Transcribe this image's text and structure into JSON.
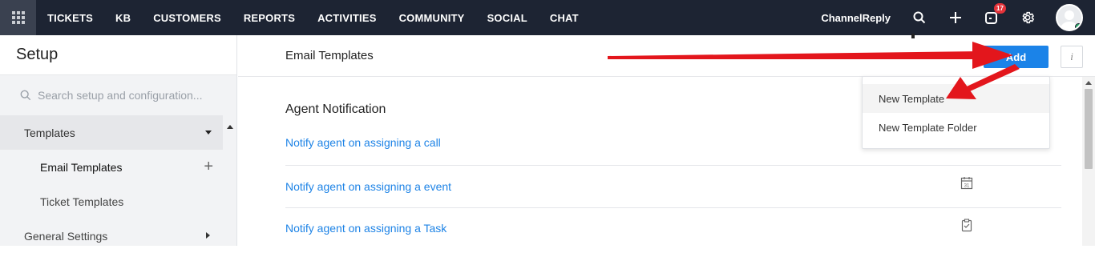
{
  "topnav": {
    "apps_icon": "grid-icon",
    "items": [
      "TICKETS",
      "KB",
      "CUSTOMERS",
      "REPORTS",
      "ACTIVITIES",
      "COMMUNITY",
      "SOCIAL",
      "CHAT"
    ],
    "brand": "ChannelReply",
    "notifications_count": "17",
    "bg_color": "#1d2433"
  },
  "sidebar": {
    "title": "Setup",
    "search_placeholder": "Search setup and configuration...",
    "section": "Templates",
    "sub_items": [
      "Email Templates",
      "Ticket Templates"
    ],
    "next_section": "General Settings"
  },
  "main": {
    "page_title": "Email Templates",
    "add_label": "Add",
    "info_label": "i",
    "section_title": "Agent Notification",
    "rows": [
      {
        "label": "Notify agent on assigning a call"
      },
      {
        "label": "Notify agent on assigning a event",
        "icon": "calendar-icon",
        "icon_text": "31"
      },
      {
        "label": "Notify agent on assigning a Task",
        "icon": "task-icon"
      }
    ]
  },
  "dropdown": {
    "items": [
      "New Template",
      "New Template Folder"
    ]
  },
  "colors": {
    "accent": "#1b83e8",
    "link": "#1d83e6",
    "annotation_arrow": "#e3161c"
  }
}
